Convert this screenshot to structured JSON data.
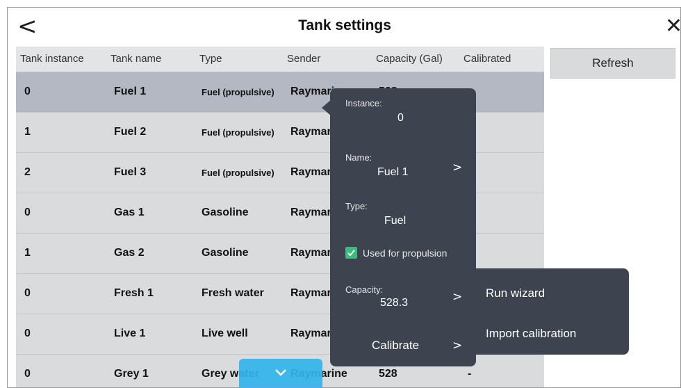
{
  "window": {
    "title": "Tank settings",
    "back_glyph": "<",
    "close_glyph": "✕"
  },
  "table": {
    "headers": [
      "Tank instance",
      "Tank name",
      "Type",
      "Sender",
      "Capacity (Gal)",
      "Calibrated"
    ],
    "rows": [
      {
        "instance": "0",
        "name": "Fuel 1",
        "type": "Fuel (propulsive)",
        "sender": "Raymarine",
        "capacity": "528",
        "calibrated": "",
        "selected": true
      },
      {
        "instance": "1",
        "name": "Fuel 2",
        "type": "Fuel (propulsive)",
        "sender": "Raymar",
        "capacity": "",
        "calibrated": ""
      },
      {
        "instance": "2",
        "name": "Fuel 3",
        "type": "Fuel (propulsive)",
        "sender": "Raymar",
        "capacity": "",
        "calibrated": ""
      },
      {
        "instance": "0",
        "name": "Gas 1",
        "type": "Gasoline",
        "sender": "Raymar",
        "capacity": "",
        "calibrated": ""
      },
      {
        "instance": "1",
        "name": "Gas 2",
        "type": "Gasoline",
        "sender": "Raymar",
        "capacity": "",
        "calibrated": ""
      },
      {
        "instance": "0",
        "name": "Fresh 1",
        "type": "Fresh water",
        "sender": "Raymar",
        "capacity": "",
        "calibrated": ""
      },
      {
        "instance": "0",
        "name": "Live 1",
        "type": "Live well",
        "sender": "Raymar",
        "capacity": "",
        "calibrated": ""
      },
      {
        "instance": "0",
        "name": "Grey 1",
        "type": "Grey water",
        "sender": "Raymarine",
        "capacity": "528",
        "calibrated": "-"
      }
    ]
  },
  "refresh_label": "Refresh",
  "popup": {
    "instance_label": "Instance:",
    "instance_value": "0",
    "name_label": "Name:",
    "name_value": "Fuel 1",
    "type_label": "Type:",
    "type_value": "Fuel",
    "propulsion_label": "Used for propulsion",
    "propulsion_checked": true,
    "capacity_label": "Capacity:",
    "capacity_value": "528.3",
    "calibrate_label": "Calibrate",
    "chevron": ">"
  },
  "submenu": {
    "items": [
      "Run wizard",
      "Import calibration"
    ]
  },
  "colors": {
    "popup_bg": "#3d4450",
    "checkbox": "#35c07a",
    "scroll_handle": "#33b4ea",
    "selected_row": "#b4b8c2"
  },
  "icons": {
    "back": "chevron-left-icon",
    "close": "close-icon",
    "check": "checkmark-icon",
    "scroll": "chevron-down-icon"
  }
}
